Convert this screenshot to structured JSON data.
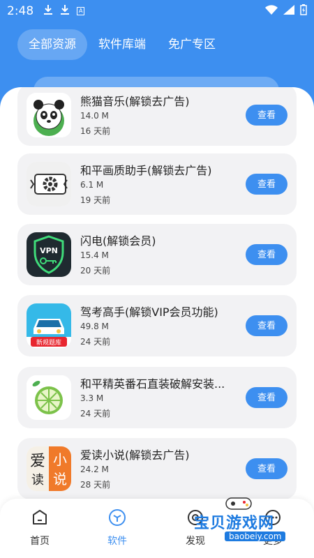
{
  "status": {
    "time": "2:48",
    "icons": [
      "download-icon",
      "download-icon",
      "app-notify-icon"
    ],
    "notify_letter": "A"
  },
  "tabs": [
    {
      "label": "全部资源",
      "active": true
    },
    {
      "label": "软件库端",
      "active": false
    },
    {
      "label": "免广专区",
      "active": false
    }
  ],
  "apps": [
    {
      "name": "熊猫音乐(解锁去广告)",
      "size": "14.0 M",
      "time": "16 天前",
      "button": "查看",
      "icon": "panda-icon"
    },
    {
      "name": "和平画质助手(解锁去广告)",
      "size": "6.1 M",
      "time": "19 天前",
      "button": "查看",
      "icon": "gear-icon"
    },
    {
      "name": "闪电(解锁会员)",
      "size": "15.4 M",
      "time": "20 天前",
      "button": "查看",
      "icon": "vpn-shield-icon",
      "icon_text": "VPN"
    },
    {
      "name": "驾考高手(解锁VIP会员功能)",
      "size": "49.8 M",
      "time": "24 天前",
      "button": "查看",
      "icon": "car-icon",
      "icon_text": "新规题库"
    },
    {
      "name": "和平精英番石直装破解安装...",
      "size": "3.3 M",
      "time": "24 天前",
      "button": "查看",
      "icon": "lime-icon"
    },
    {
      "name": "爱读小说(解锁去广告)",
      "size": "24.2 M",
      "time": "28 天前",
      "button": "查看",
      "icon": "novel-icon",
      "icon_text": [
        "爱",
        "读",
        "小",
        "说"
      ]
    }
  ],
  "nav": [
    {
      "label": "首页",
      "icon": "home-icon",
      "active": false
    },
    {
      "label": "软件",
      "icon": "cube-icon",
      "active": true
    },
    {
      "label": "发现",
      "icon": "discover-icon",
      "active": false
    },
    {
      "label": "更多",
      "icon": "more-icon",
      "active": false
    }
  ],
  "watermark": {
    "text": "宝贝游戏网",
    "url": "baobeiy.com"
  },
  "colors": {
    "primary": "#3d8ff0",
    "card_bg": "#f2f2f4"
  }
}
